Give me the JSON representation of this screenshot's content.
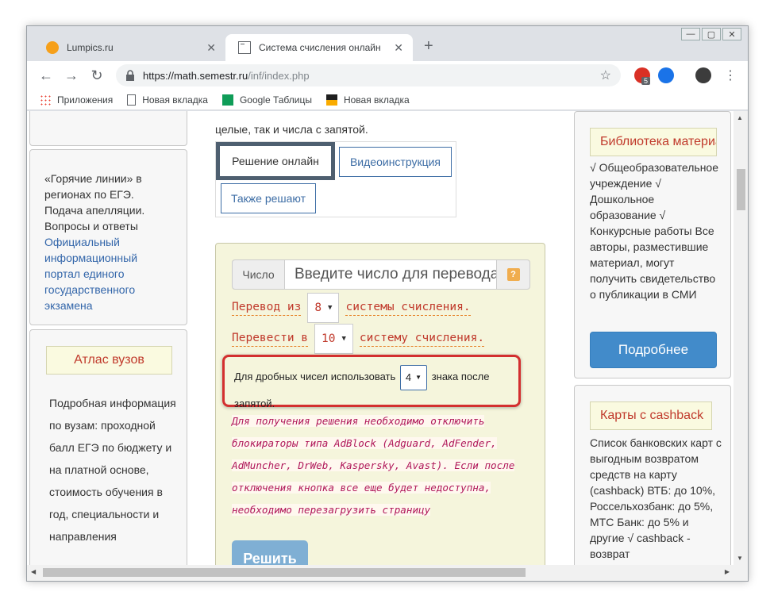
{
  "window": {
    "min": "—",
    "max": "▢",
    "close": "✕"
  },
  "tabs": [
    {
      "title": "Lumpics.ru",
      "close": "✕"
    },
    {
      "title": "Система счисления онлайн",
      "close": "✕"
    }
  ],
  "new_tab": "+",
  "toolbar": {
    "back": "←",
    "forward": "→",
    "reload": "↻",
    "url_host": "https://math.semestr.ru",
    "url_path": "/inf/index.php",
    "star": "☆",
    "ext_badge": "5",
    "menu": "⋮"
  },
  "bookmarks": [
    {
      "label": "Приложения",
      "icon": "apps-icon"
    },
    {
      "label": "Новая вкладка",
      "icon": "document-icon"
    },
    {
      "label": "Google Таблицы",
      "icon": "sheets-icon"
    },
    {
      "label": "Новая вкладка",
      "icon": "image-icon"
    }
  ],
  "left": {
    "hotline_text": "«Горячие линии» в регионах по ЕГЭ. Подача апелляции. Вопросы и ответы",
    "hotline_link": "Официальный информационный портал единого государственного экзамена",
    "atlas_title": "Атлас вузов",
    "atlas_text": "Подробная информация по вузам: проходной балл ЕГЭ по бюджету и на платной основе, стоимость обучения в год, специальности и направления"
  },
  "main": {
    "top_text": "целые, так и числа с запятой.",
    "tab_solve": "Решение онлайн",
    "tab_video": "Видеоинструкция",
    "tab_also": "Также решают",
    "number_label": "Число",
    "number_placeholder": "Введите число для перевода",
    "help": "?",
    "from_prefix": "Перевод из",
    "from_value": "8",
    "from_suffix": "системы счисления.",
    "to_prefix": "Перевести в",
    "to_value": "10",
    "to_suffix": "систему счисления.",
    "frac_prefix": "Для дробных чисел использовать",
    "frac_value": "4",
    "frac_suffix": "знака после запятой.",
    "warning": "Для получения решения необходимо отключить блокираторы типа AdBlock (Adguard, AdFender, AdMuncher, DrWeb, Kaspersky, Avast). Если после отключения кнопка все еще будет недоступна, необходимо перезагрузить страницу",
    "solve_button": "Решить"
  },
  "right": {
    "lib_title": "Библиотека материалов",
    "lib_text": "√ Общеобразовательное учреждение √ Дошкольное образование √ Конкурсные работы Все авторы, разместившие материал, могут получить свидетельство о публикации в СМИ",
    "more_button": "Подробнее",
    "cards_title": "Карты с cashback",
    "cards_text": "Список банковских карт с выгодным возвратом средств на карту (cashback) ВТБ: до 10%, Россельхозбанк: до 5%, МТС Банк: до 5% и другие √ cashback - возврат"
  },
  "colors": {
    "accent": "#428bca",
    "warning": "#b0185a",
    "highlight": "#d32f2f"
  }
}
